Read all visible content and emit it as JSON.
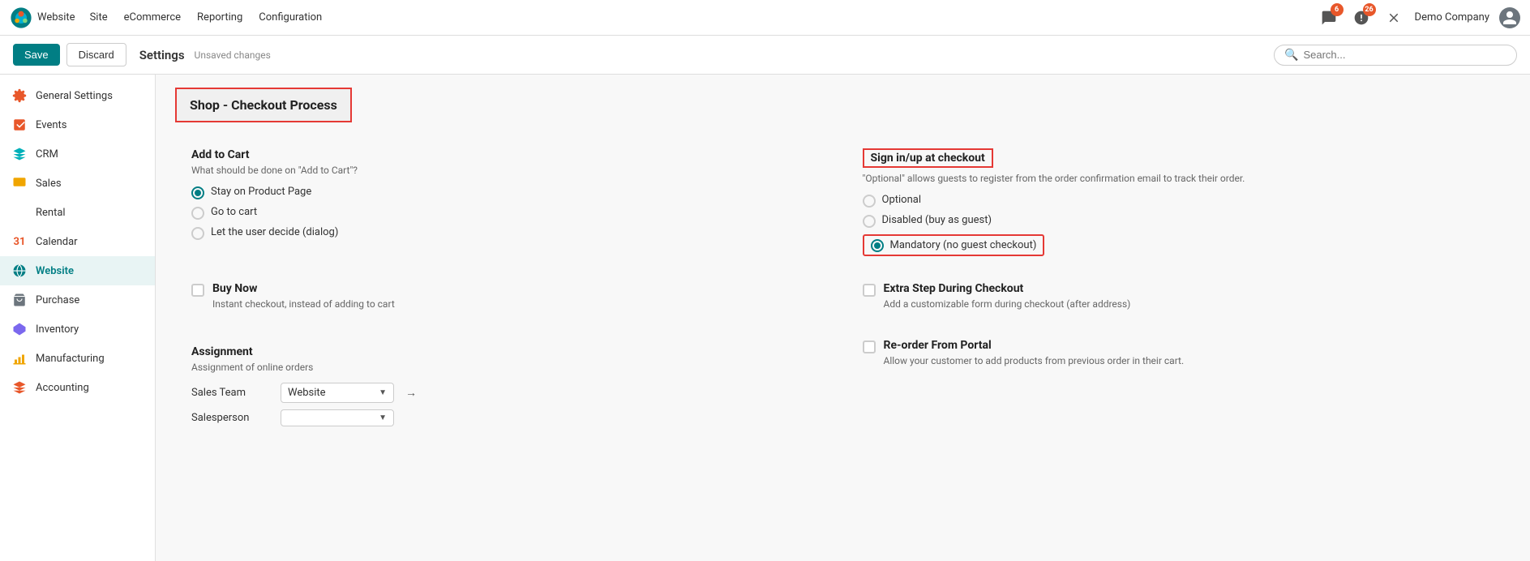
{
  "app": {
    "name": "Website",
    "nav_links": [
      "Site",
      "eCommerce",
      "Reporting",
      "Configuration"
    ]
  },
  "header": {
    "notifications_count": "6",
    "activity_count": "26",
    "company": "Demo Company"
  },
  "toolbar": {
    "save_label": "Save",
    "discard_label": "Discard",
    "settings_label": "Settings",
    "unsaved_label": "Unsaved changes",
    "search_placeholder": "Search..."
  },
  "sidebar": {
    "items": [
      {
        "id": "general-settings",
        "label": "General Settings",
        "icon": "⚙",
        "color": "#e8572a",
        "active": false
      },
      {
        "id": "events",
        "label": "Events",
        "icon": "✕",
        "color": "#e8572a",
        "active": false
      },
      {
        "id": "crm",
        "label": "CRM",
        "icon": "◆",
        "color": "#00b0b9",
        "active": false
      },
      {
        "id": "sales",
        "label": "Sales",
        "icon": "▐",
        "color": "#f0a500",
        "active": false
      },
      {
        "id": "rental",
        "label": "Rental",
        "icon": "✏",
        "color": "#7b68ee",
        "active": false
      },
      {
        "id": "calendar",
        "label": "Calendar",
        "icon": "31",
        "color": "#e8572a",
        "active": false
      },
      {
        "id": "website",
        "label": "Website",
        "icon": "●",
        "color": "#017e84",
        "active": true
      },
      {
        "id": "purchase",
        "label": "Purchase",
        "icon": "▣",
        "color": "#6c757d",
        "active": false
      },
      {
        "id": "inventory",
        "label": "Inventory",
        "icon": "⬡",
        "color": "#7b68ee",
        "active": false
      },
      {
        "id": "manufacturing",
        "label": "Manufacturing",
        "icon": "⚙",
        "color": "#f0a500",
        "active": false
      },
      {
        "id": "accounting",
        "label": "Accounting",
        "icon": "✕",
        "color": "#e8572a",
        "active": false
      }
    ]
  },
  "main": {
    "section_title": "Shop - Checkout Process",
    "blocks": {
      "add_to_cart": {
        "title": "Add to Cart",
        "desc": "What should be done on \"Add to Cart\"?",
        "options": [
          {
            "id": "stay",
            "label": "Stay on Product Page",
            "checked": true
          },
          {
            "id": "go",
            "label": "Go to cart",
            "checked": false
          },
          {
            "id": "user",
            "label": "Let the user decide (dialog)",
            "checked": false
          }
        ]
      },
      "sign_in": {
        "title": "Sign in/up at checkout",
        "desc": "\"Optional\" allows guests to register from the order confirmation email to track their order.",
        "options": [
          {
            "id": "optional",
            "label": "Optional",
            "checked": false
          },
          {
            "id": "disabled",
            "label": "Disabled (buy as guest)",
            "checked": false
          },
          {
            "id": "mandatory",
            "label": "Mandatory (no guest checkout)",
            "checked": true
          }
        ]
      },
      "buy_now": {
        "title": "Buy Now",
        "desc": "Instant checkout, instead of adding to cart",
        "checked": false
      },
      "extra_step": {
        "title": "Extra Step During Checkout",
        "desc": "Add a customizable form during checkout (after address)",
        "checked": false
      },
      "assignment": {
        "title": "Assignment",
        "desc": "Assignment of online orders",
        "sales_team_label": "Sales Team",
        "sales_team_value": "Website",
        "salesperson_label": "Salesperson"
      },
      "reorder": {
        "title": "Re-order From Portal",
        "desc": "Allow your customer to add products from previous order in their cart.",
        "checked": false
      }
    }
  }
}
